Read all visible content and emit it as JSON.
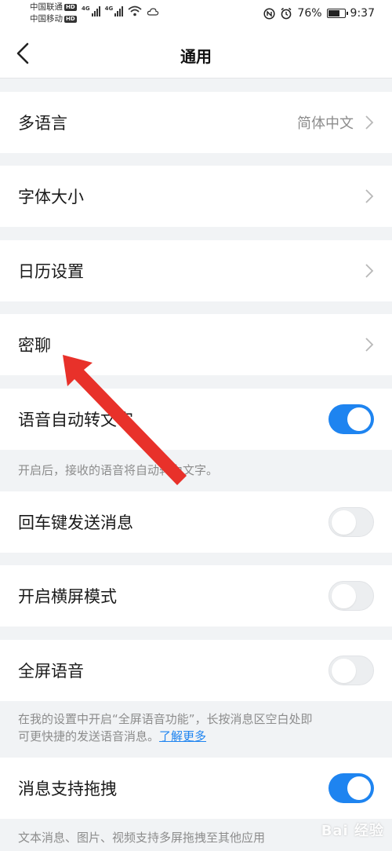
{
  "status_bar": {
    "carrier1": "中国联通",
    "carrier2": "中国移动",
    "hd": "HD",
    "net_tag": "4G",
    "battery_percent": "76%",
    "battery_level": 0.76,
    "time": "9:37"
  },
  "nav": {
    "title": "通用",
    "back_icon": "chevron-left-icon"
  },
  "settings": {
    "language": {
      "label": "多语言",
      "value": "简体中文"
    },
    "font_size": {
      "label": "字体大小"
    },
    "calendar": {
      "label": "日历设置"
    },
    "secret_chat": {
      "label": "密聊"
    },
    "voice_to_text": {
      "label": "语音自动转文字",
      "enabled": true,
      "note": "开启后，接收的语音将自动转为文字。"
    },
    "enter_send": {
      "label": "回车键发送消息",
      "enabled": false
    },
    "landscape": {
      "label": "开启横屏模式",
      "enabled": false
    },
    "fullscreen_voice": {
      "label": "全屏语音",
      "enabled": false,
      "note_line1": "在我的设置中开启“全屏语音功能”，长按消息区空白处即",
      "note_line2": "可更快捷的发送语音消息。",
      "learn_more": "了解更多"
    },
    "drag_messages": {
      "label": "消息支持拖拽",
      "enabled": true,
      "note": "文本消息、图片、视频支持多屏拖拽至其他应用"
    }
  },
  "watermark": "Bai 经验",
  "colors": {
    "accent": "#1e84f0",
    "annotation_arrow": "#e8312a",
    "background": "#f1f3f5"
  }
}
